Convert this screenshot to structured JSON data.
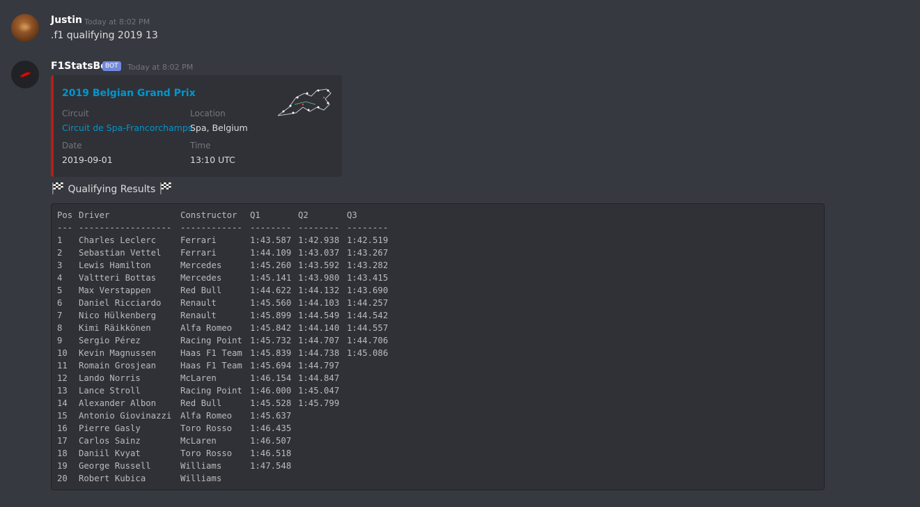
{
  "messages": [
    {
      "username": "Justin",
      "timestamp": "Today at 8:02 PM",
      "text": ".f1 qualifying 2019 13"
    },
    {
      "username": "F1StatsBot",
      "bot_tag": "BOT",
      "timestamp": "Today at 8:02 PM"
    }
  ],
  "embed": {
    "accent_color": "#b3201a",
    "title": "2019 Belgian Grand Prix",
    "fields": {
      "circuit_label": "Circuit",
      "circuit_value": "Circuit de Spa-Francorchamps",
      "location_label": "Location",
      "location_value": "Spa, Belgium",
      "date_label": "Date",
      "date_value": "2019-09-01",
      "time_label": "Time",
      "time_value": "13:10 UTC"
    }
  },
  "results_title": "Qualifying Results",
  "table": {
    "headers": [
      "Pos",
      "Driver",
      "Constructor",
      "Q1",
      "Q2",
      "Q3"
    ],
    "separators": [
      "---",
      "------------------",
      "------------",
      "--------",
      "--------",
      "--------"
    ],
    "rows": [
      [
        "1",
        "Charles Leclerc",
        "Ferrari",
        "1:43.587",
        "1:42.938",
        "1:42.519"
      ],
      [
        "2",
        "Sebastian Vettel",
        "Ferrari",
        "1:44.109",
        "1:43.037",
        "1:43.267"
      ],
      [
        "3",
        "Lewis Hamilton",
        "Mercedes",
        "1:45.260",
        "1:43.592",
        "1:43.282"
      ],
      [
        "4",
        "Valtteri Bottas",
        "Mercedes",
        "1:45.141",
        "1:43.980",
        "1:43.415"
      ],
      [
        "5",
        "Max Verstappen",
        "Red Bull",
        "1:44.622",
        "1:44.132",
        "1:43.690"
      ],
      [
        "6",
        "Daniel Ricciardo",
        "Renault",
        "1:45.560",
        "1:44.103",
        "1:44.257"
      ],
      [
        "7",
        "Nico Hülkenberg",
        "Renault",
        "1:45.899",
        "1:44.549",
        "1:44.542"
      ],
      [
        "8",
        "Kimi Räikkönen",
        "Alfa Romeo",
        "1:45.842",
        "1:44.140",
        "1:44.557"
      ],
      [
        "9",
        "Sergio Pérez",
        "Racing Point",
        "1:45.732",
        "1:44.707",
        "1:44.706"
      ],
      [
        "10",
        "Kevin Magnussen",
        "Haas F1 Team",
        "1:45.839",
        "1:44.738",
        "1:45.086"
      ],
      [
        "11",
        "Romain Grosjean",
        "Haas F1 Team",
        "1:45.694",
        "1:44.797",
        ""
      ],
      [
        "12",
        "Lando Norris",
        "McLaren",
        "1:46.154",
        "1:44.847",
        ""
      ],
      [
        "13",
        "Lance Stroll",
        "Racing Point",
        "1:46.000",
        "1:45.047",
        ""
      ],
      [
        "14",
        "Alexander Albon",
        "Red Bull",
        "1:45.528",
        "1:45.799",
        ""
      ],
      [
        "15",
        "Antonio Giovinazzi",
        "Alfa Romeo",
        "1:45.637",
        "",
        ""
      ],
      [
        "16",
        "Pierre Gasly",
        "Toro Rosso",
        "1:46.435",
        "",
        ""
      ],
      [
        "17",
        "Carlos Sainz",
        "McLaren",
        "1:46.507",
        "",
        ""
      ],
      [
        "18",
        "Daniil Kvyat",
        "Toro Rosso",
        "1:46.518",
        "",
        ""
      ],
      [
        "19",
        "George Russell",
        "Williams",
        "1:47.548",
        "",
        ""
      ],
      [
        "20",
        "Robert Kubica",
        "Williams",
        "",
        "",
        ""
      ]
    ]
  }
}
